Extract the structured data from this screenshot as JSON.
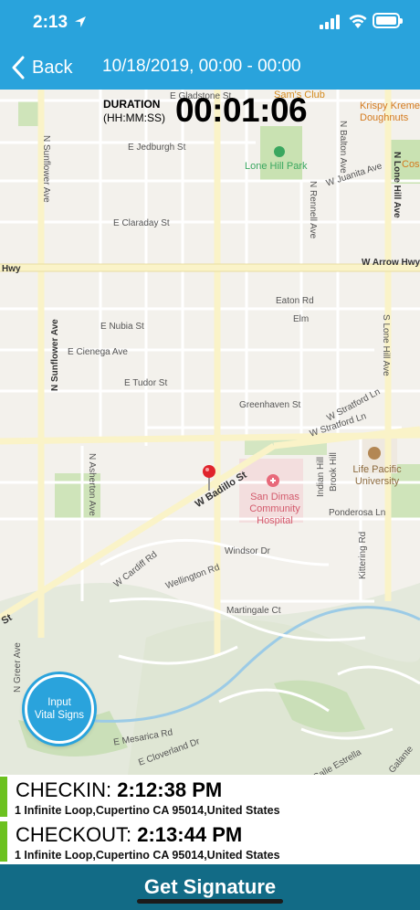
{
  "status_bar": {
    "time": "2:13"
  },
  "nav": {
    "back_label": "Back",
    "title": "10/18/2019, 00:00 - 00:00"
  },
  "duration": {
    "label": "DURATION",
    "format": "(HH:MM:SS)",
    "value": "00:01:06"
  },
  "map": {
    "streets": {
      "gladstone": "E Gladstone St",
      "jedburgh": "E Jedburgh St",
      "claraday": "E Claraday St",
      "arrow_hwy_left": "Hwy",
      "arrow_hwy": "W Arrow Hwy",
      "nubia": "E Nubia St",
      "cienega": "E Cienega Ave",
      "tudor": "E Tudor St",
      "eaton": "Eaton Rd",
      "elm": "Elm",
      "greenhaven": "Greenhaven St",
      "stratford_ln": "W Stratford Ln",
      "stratford": "W Stratford Ln",
      "badillo": "W Badillo St",
      "st_left": "St",
      "cardiff": "W Cardiff Rd",
      "wellington": "Wellington Rd",
      "windsor": "Windsor Dr",
      "martingale": "Martingale Ct",
      "mesarica": "E Mesarica Rd",
      "cloverland": "E Cloverland Dr",
      "calle_estrella": "Calle Estrella",
      "galante": "Galante",
      "ponderosa": "Ponderosa Ln",
      "juanita": "W Juanita Ave",
      "n_sunflower_top": "N Sunflower Ave",
      "n_sunflower": "N Sunflower Ave",
      "n_asherton": "N Asherton Ave",
      "n_rennell": "N Rennell Ave",
      "n_balton": "N Balton Ave",
      "n_lone_hill": "N Lone Hill Ave",
      "s_lone_hill": "S Lone Hill Ave",
      "indian_hill": "Indian Hill",
      "brook_hill": "Brook Hill",
      "kittering": "Kittering Rd",
      "n_greer": "N Greer Ave"
    },
    "pois": {
      "sams_club": "Sam's Club",
      "krispy_kreme": "Krispy Kreme Doughnuts",
      "costco": "Cos",
      "lone_hill_park": "Lone Hill Park",
      "hospital": "San Dimas Community Hospital",
      "university": "Life Pacific University"
    }
  },
  "vital_signs_button": {
    "line1": "Input",
    "line2": "Vital Signs"
  },
  "checkin": {
    "label": "CHECKIN:",
    "time": "2:12:38 PM",
    "address": "1 Infinite Loop,Cupertino CA 95014,United States"
  },
  "checkout": {
    "label": "CHECKOUT:",
    "time": "2:13:44 PM",
    "address": "1 Infinite Loop,Cupertino CA 95014,United States"
  },
  "signature_button": {
    "label": "Get Signature"
  },
  "colors": {
    "nav_bar": "#29a3dc",
    "footer": "#126b86",
    "accent_green": "#6cc11f",
    "pin": "#e0242b"
  }
}
